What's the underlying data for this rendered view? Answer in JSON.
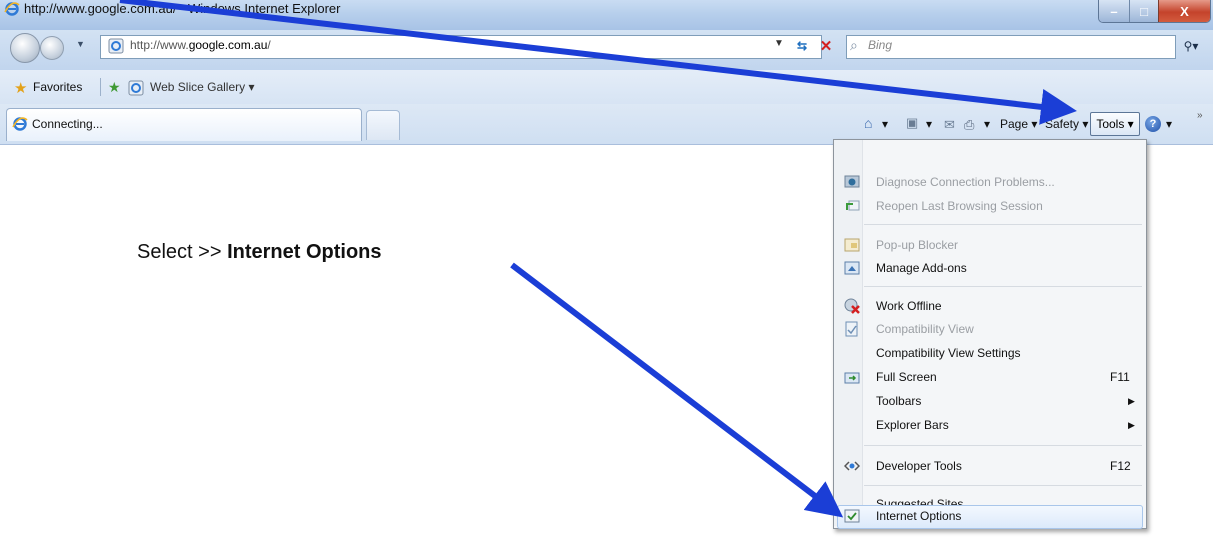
{
  "window": {
    "title": "http://www.google.com.au/ - Windows Internet Explorer",
    "controls": {
      "minimize": "–",
      "maximize": "□",
      "close": "X"
    }
  },
  "navbar": {
    "address_prefix": "http://www.",
    "address_domain": "google.com.au",
    "address_suffix": "/",
    "search_placeholder": "Bing",
    "search_button": "▾"
  },
  "favorites_bar": {
    "favorites_label": "Favorites",
    "web_slice_label": "Web Slice Gallery ▾"
  },
  "tabs": [
    {
      "label": "Connecting..."
    }
  ],
  "command_bar": {
    "home_dd": "▾",
    "feeds_dd": "▾",
    "print_dd": "▾",
    "page": "Page ▾",
    "safety": "Safety ▾",
    "tools": "Tools ▾",
    "help_dd": "▾",
    "overflow": "»"
  },
  "instruction": {
    "prefix": "Select >> ",
    "bold": "Internet Options"
  },
  "tools_menu": {
    "items": [
      {
        "label": "Diagnose Connection Problems...",
        "disabled": true,
        "icon": "diagnose-icon"
      },
      {
        "label": "Reopen Last Browsing Session",
        "disabled": true,
        "icon": "reopen-session-icon"
      },
      {
        "label": "Pop-up Blocker",
        "disabled": true,
        "icon": "popup-blocker-icon"
      },
      {
        "label": "Manage Add-ons",
        "disabled": false,
        "icon": "addons-icon"
      },
      {
        "label": "Work Offline",
        "disabled": false,
        "icon": "work-offline-icon"
      },
      {
        "label": "Compatibility View",
        "disabled": true,
        "icon": "compatibility-view-icon"
      },
      {
        "label": "Compatibility View Settings",
        "disabled": false
      },
      {
        "label": "Full Screen",
        "shortcut": "F11",
        "disabled": false,
        "icon": "full-screen-icon"
      },
      {
        "label": "Toolbars",
        "submenu": true,
        "disabled": false
      },
      {
        "label": "Explorer Bars",
        "submenu": true,
        "disabled": false
      },
      {
        "label": "Developer Tools",
        "shortcut": "F12",
        "disabled": false,
        "icon": "developer-tools-icon"
      },
      {
        "label": "Suggested Sites",
        "disabled": false
      },
      {
        "label": "Internet Options",
        "disabled": false,
        "highlighted": true,
        "icon": "internet-options-icon"
      }
    ],
    "submenu_glyph": "▶"
  }
}
